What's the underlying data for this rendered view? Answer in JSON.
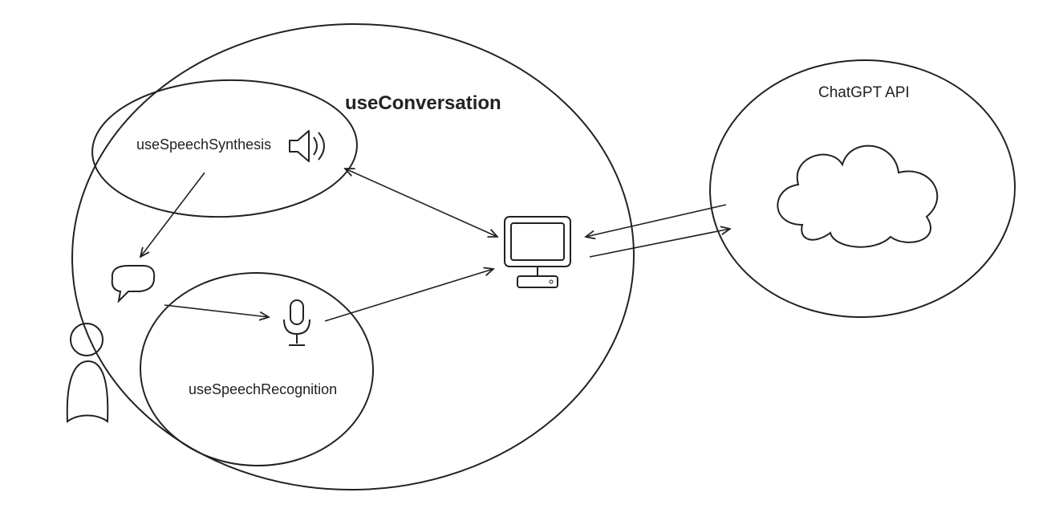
{
  "nodes": {
    "conversation": {
      "label": "useConversation"
    },
    "synthesis": {
      "label": "useSpeechSynthesis"
    },
    "recognition": {
      "label": "useSpeechRecognition"
    },
    "api": {
      "label": "ChatGPT API"
    }
  },
  "icons": {
    "user": "user-icon",
    "speech": "speech-bubble-icon",
    "speaker": "speaker-icon",
    "mic": "microphone-icon",
    "computer": "computer-icon",
    "cloud": "cloud-icon"
  }
}
